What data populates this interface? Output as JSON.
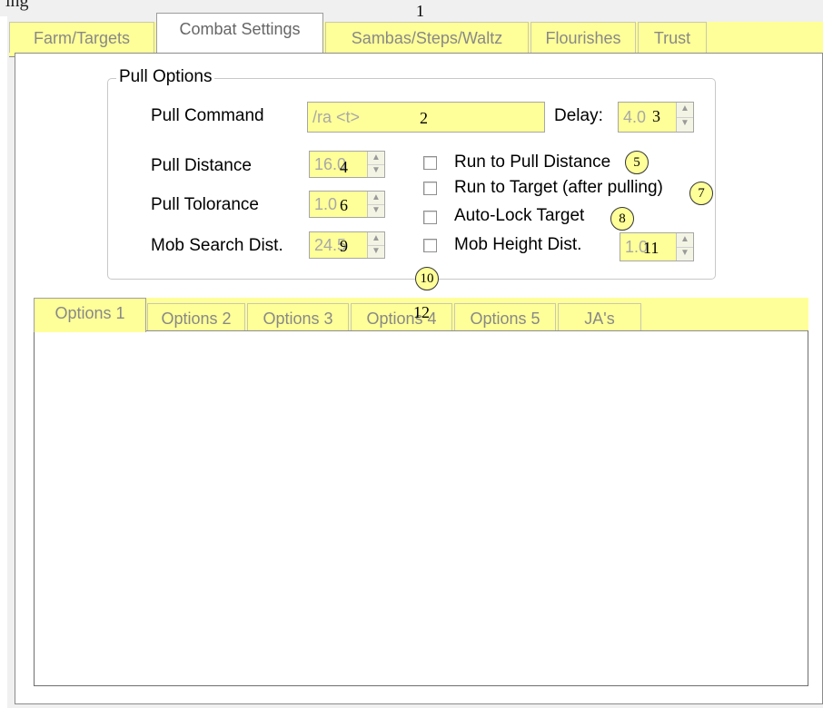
{
  "caption_fragment": "ing",
  "main_tabs": [
    {
      "label": "Farm/Targets"
    },
    {
      "label": "Combat Settings"
    },
    {
      "label": "Sambas/Steps/Waltz"
    },
    {
      "label": "Flourishes"
    },
    {
      "label": "Trust"
    }
  ],
  "pull_options": {
    "title": "Pull Options",
    "pull_command_label": "Pull Command",
    "pull_command_value": "/ra <t>",
    "delay_label": "Delay:",
    "delay_value": "4.0",
    "pull_distance_label": "Pull Distance",
    "pull_distance_value": "16.0",
    "pull_tolerance_label": "Pull Tolorance",
    "pull_tolerance_value": "1.0",
    "mob_search_label": "Mob Search Dist.",
    "mob_search_value": "24.5",
    "mob_height_value": "1.0",
    "checkboxes": [
      {
        "label": "Run to Pull Distance",
        "checked": false
      },
      {
        "label": "Run to Target (after pulling)",
        "checked": false
      },
      {
        "label": "Auto-Lock Target",
        "checked": false
      },
      {
        "label": "Mob Height Dist.",
        "checked": false
      }
    ]
  },
  "sub_tabs": [
    {
      "label": "Options 1"
    },
    {
      "label": "Options 2"
    },
    {
      "label": "Options 3"
    },
    {
      "label": "Options 4"
    },
    {
      "label": "Options 5"
    },
    {
      "label": "JA's"
    }
  ],
  "annotations": [
    "1",
    "2",
    "3",
    "4",
    "5",
    "6",
    "7",
    "8",
    "9",
    "10",
    "11",
    "12"
  ],
  "colors": {
    "highlight": "#ffff99",
    "panel": "#f0f0f0"
  }
}
